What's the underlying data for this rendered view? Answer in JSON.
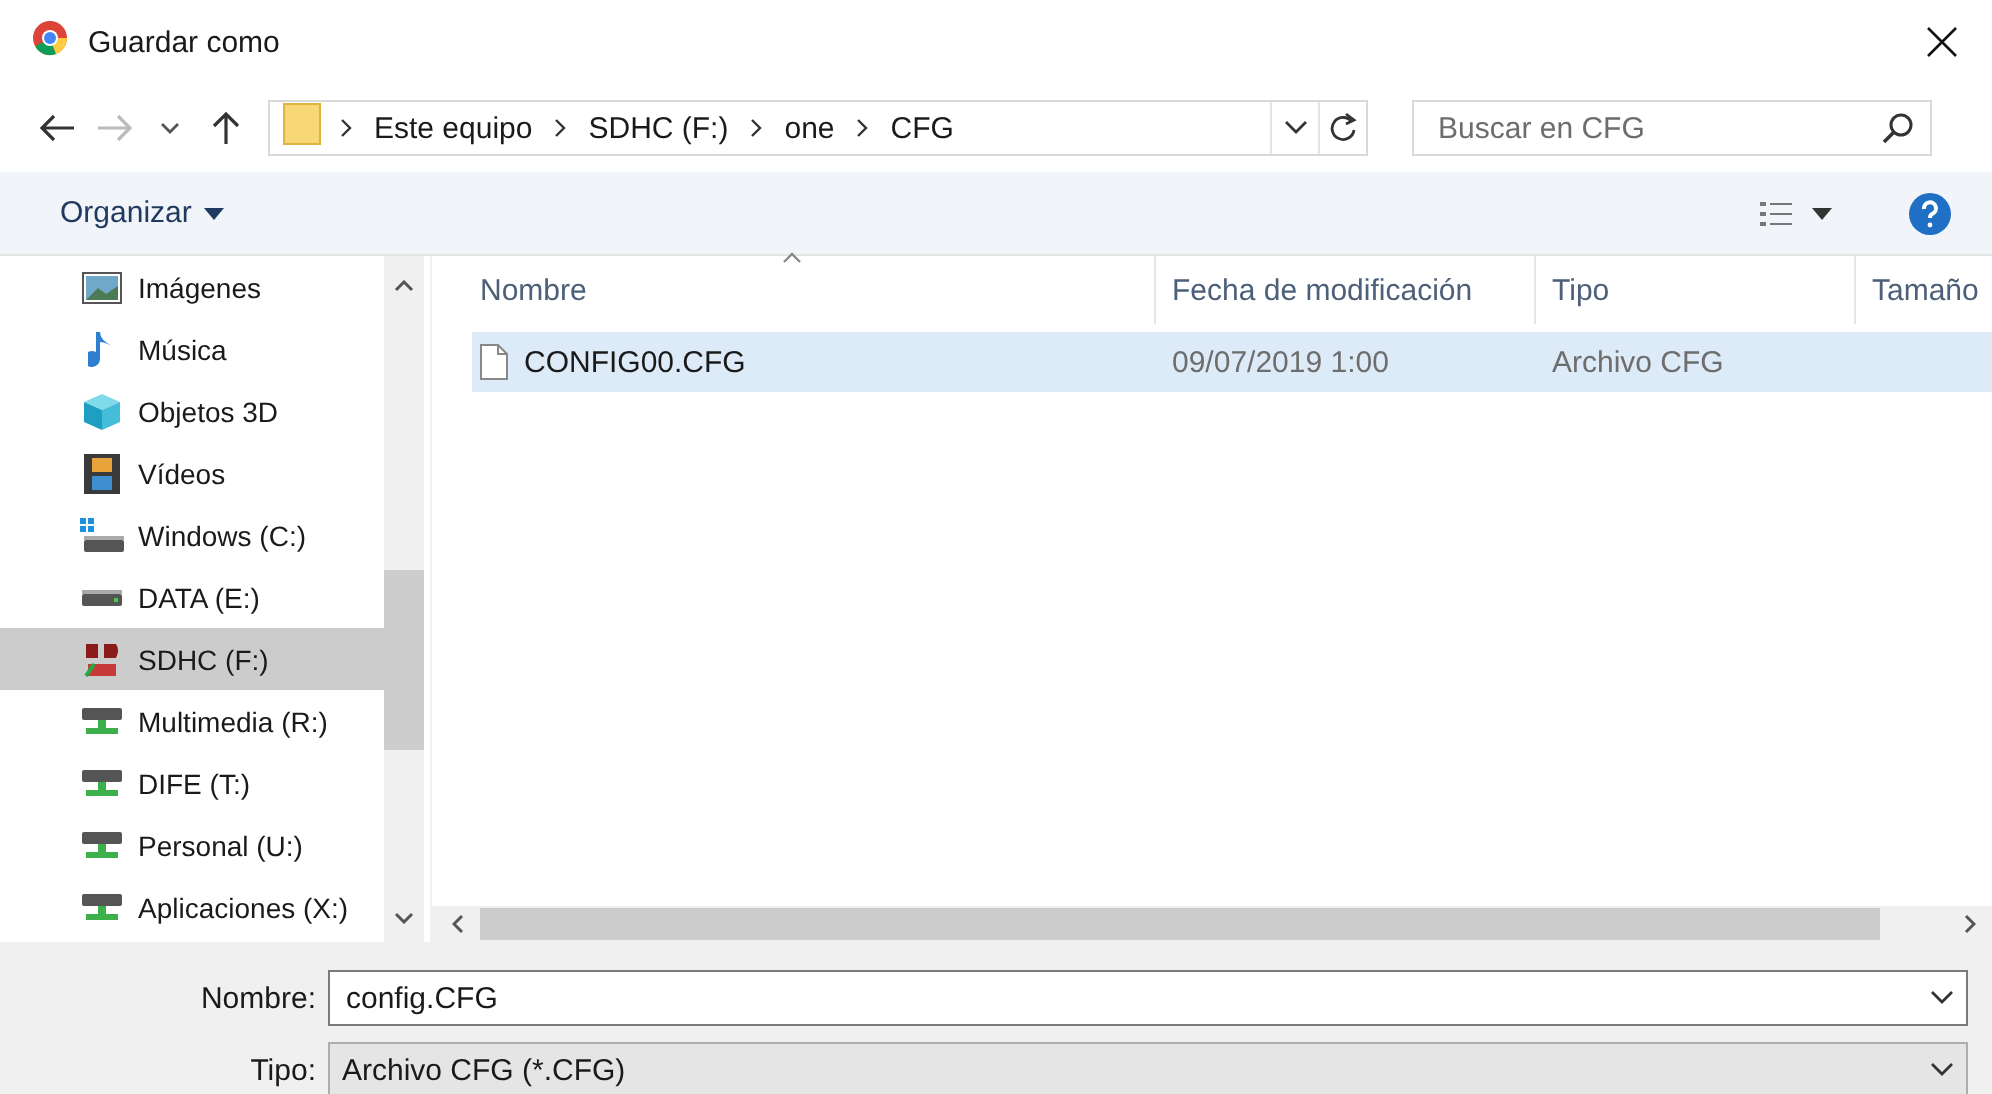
{
  "window": {
    "title": "Guardar como"
  },
  "address_bar": {
    "segments": [
      "Este equipo",
      "SDHC (F:)",
      "one",
      "CFG"
    ]
  },
  "search": {
    "placeholder": "Buscar en CFG"
  },
  "toolbar": {
    "organize": "Organizar"
  },
  "sidebar": {
    "items": [
      {
        "label": "Imágenes",
        "kind": "pictures",
        "selected": false
      },
      {
        "label": "Música",
        "kind": "music",
        "selected": false
      },
      {
        "label": "Objetos 3D",
        "kind": "objects3d",
        "selected": false
      },
      {
        "label": "Vídeos",
        "kind": "videos",
        "selected": false
      },
      {
        "label": "Windows (C:)",
        "kind": "system-drive",
        "selected": false
      },
      {
        "label": "DATA (E:)",
        "kind": "drive",
        "selected": false
      },
      {
        "label": "SDHC (F:)",
        "kind": "sd-card",
        "selected": true
      },
      {
        "label": "Multimedia (R:)",
        "kind": "network-drive",
        "selected": false
      },
      {
        "label": "DIFE (T:)",
        "kind": "network-drive",
        "selected": false
      },
      {
        "label": "Personal (U:)",
        "kind": "network-drive",
        "selected": false
      },
      {
        "label": "Aplicaciones (X:)",
        "kind": "network-drive",
        "selected": false
      }
    ]
  },
  "file_list": {
    "columns": [
      {
        "label": "Nombre",
        "sorted": true
      },
      {
        "label": "Fecha de modificación",
        "sorted": false
      },
      {
        "label": "Tipo",
        "sorted": false
      },
      {
        "label": "Tamaño",
        "sorted": false
      }
    ],
    "rows": [
      {
        "name": "CONFIG00.CFG",
        "modified": "09/07/2019 1:00",
        "type": "Archivo CFG",
        "selected": true
      }
    ]
  },
  "footer": {
    "name_label": "Nombre:",
    "name_value": "config.CFG",
    "type_label": "Tipo:",
    "type_value": "Archivo CFG (*.CFG)"
  }
}
